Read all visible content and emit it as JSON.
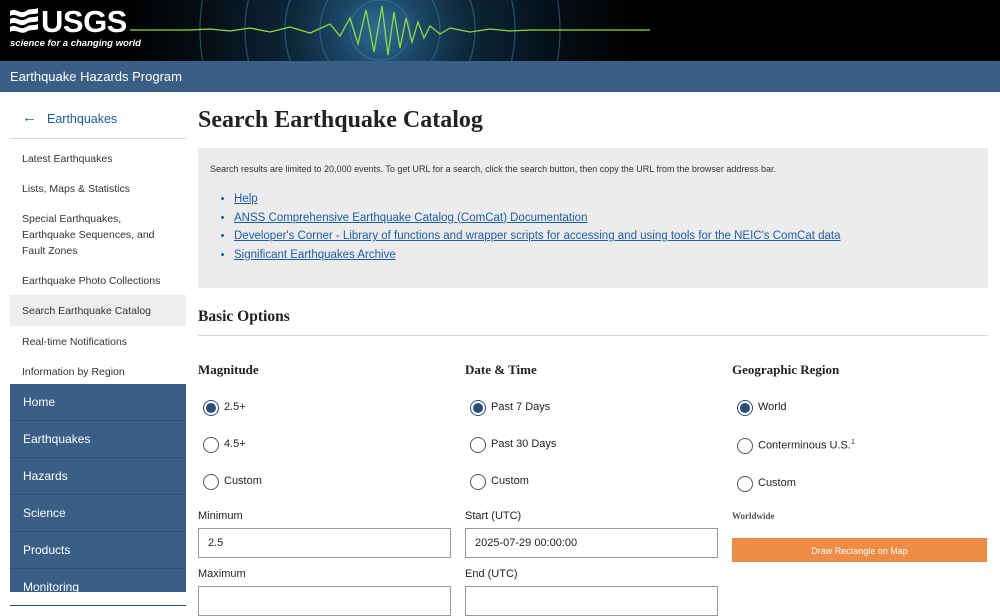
{
  "header": {
    "logo_text": "USGS",
    "logo_tagline": "science for a changing world",
    "program_name": "Earthquake Hazards Program"
  },
  "sidebar": {
    "back_label": "Earthquakes",
    "items": [
      {
        "label": "Latest Earthquakes"
      },
      {
        "label": "Lists, Maps & Statistics"
      },
      {
        "label": "Special Earthquakes, Earthquake Sequences, and Fault Zones"
      },
      {
        "label": "Earthquake Photo Collections"
      },
      {
        "label": "Search Earthquake Catalog",
        "active": true
      },
      {
        "label": "Real-time Notifications"
      },
      {
        "label": "Information by Region"
      }
    ],
    "nav": [
      {
        "label": "Home"
      },
      {
        "label": "Earthquakes"
      },
      {
        "label": "Hazards"
      },
      {
        "label": "Science"
      },
      {
        "label": "Products"
      },
      {
        "label": "Monitoring"
      }
    ]
  },
  "main": {
    "title": "Search Earthquake Catalog",
    "notice_text": "Search results are limited to 20,000 events. To get URL for a search, click the search button, then copy the URL from the browser address bar.",
    "links": [
      "Help",
      "ANSS Comprehensive Earthquake Catalog (ComCat) Documentation",
      "Developer's Corner - Library of functions and wrapper scripts for accessing and using tools for the NEIC's ComCat data",
      "Significant Earthquakes Archive"
    ],
    "section_title": "Basic Options",
    "magnitude": {
      "title": "Magnitude",
      "options": [
        "2.5+",
        "4.5+",
        "Custom"
      ],
      "selected": 0,
      "min_label": "Minimum",
      "min_value": "2.5",
      "max_label": "Maximum"
    },
    "datetime": {
      "title": "Date & Time",
      "options": [
        "Past 7 Days",
        "Past 30 Days",
        "Custom"
      ],
      "selected": 0,
      "start_label": "Start (UTC)",
      "start_value": "2025-07-29 00:00:00",
      "end_label": "End (UTC)"
    },
    "region": {
      "title": "Geographic Region",
      "options": [
        "World",
        "Conterminous U.S.",
        "Custom"
      ],
      "conus_footnote": "1",
      "selected": 0,
      "current_label": "Worldwide",
      "draw_button": "Draw Rectangle on Map"
    }
  },
  "colors": {
    "program_bar": "#3a5f87",
    "link": "#1b5ea8",
    "accent_button": "#ee8c45",
    "radio_selected": "#2b4e78"
  }
}
